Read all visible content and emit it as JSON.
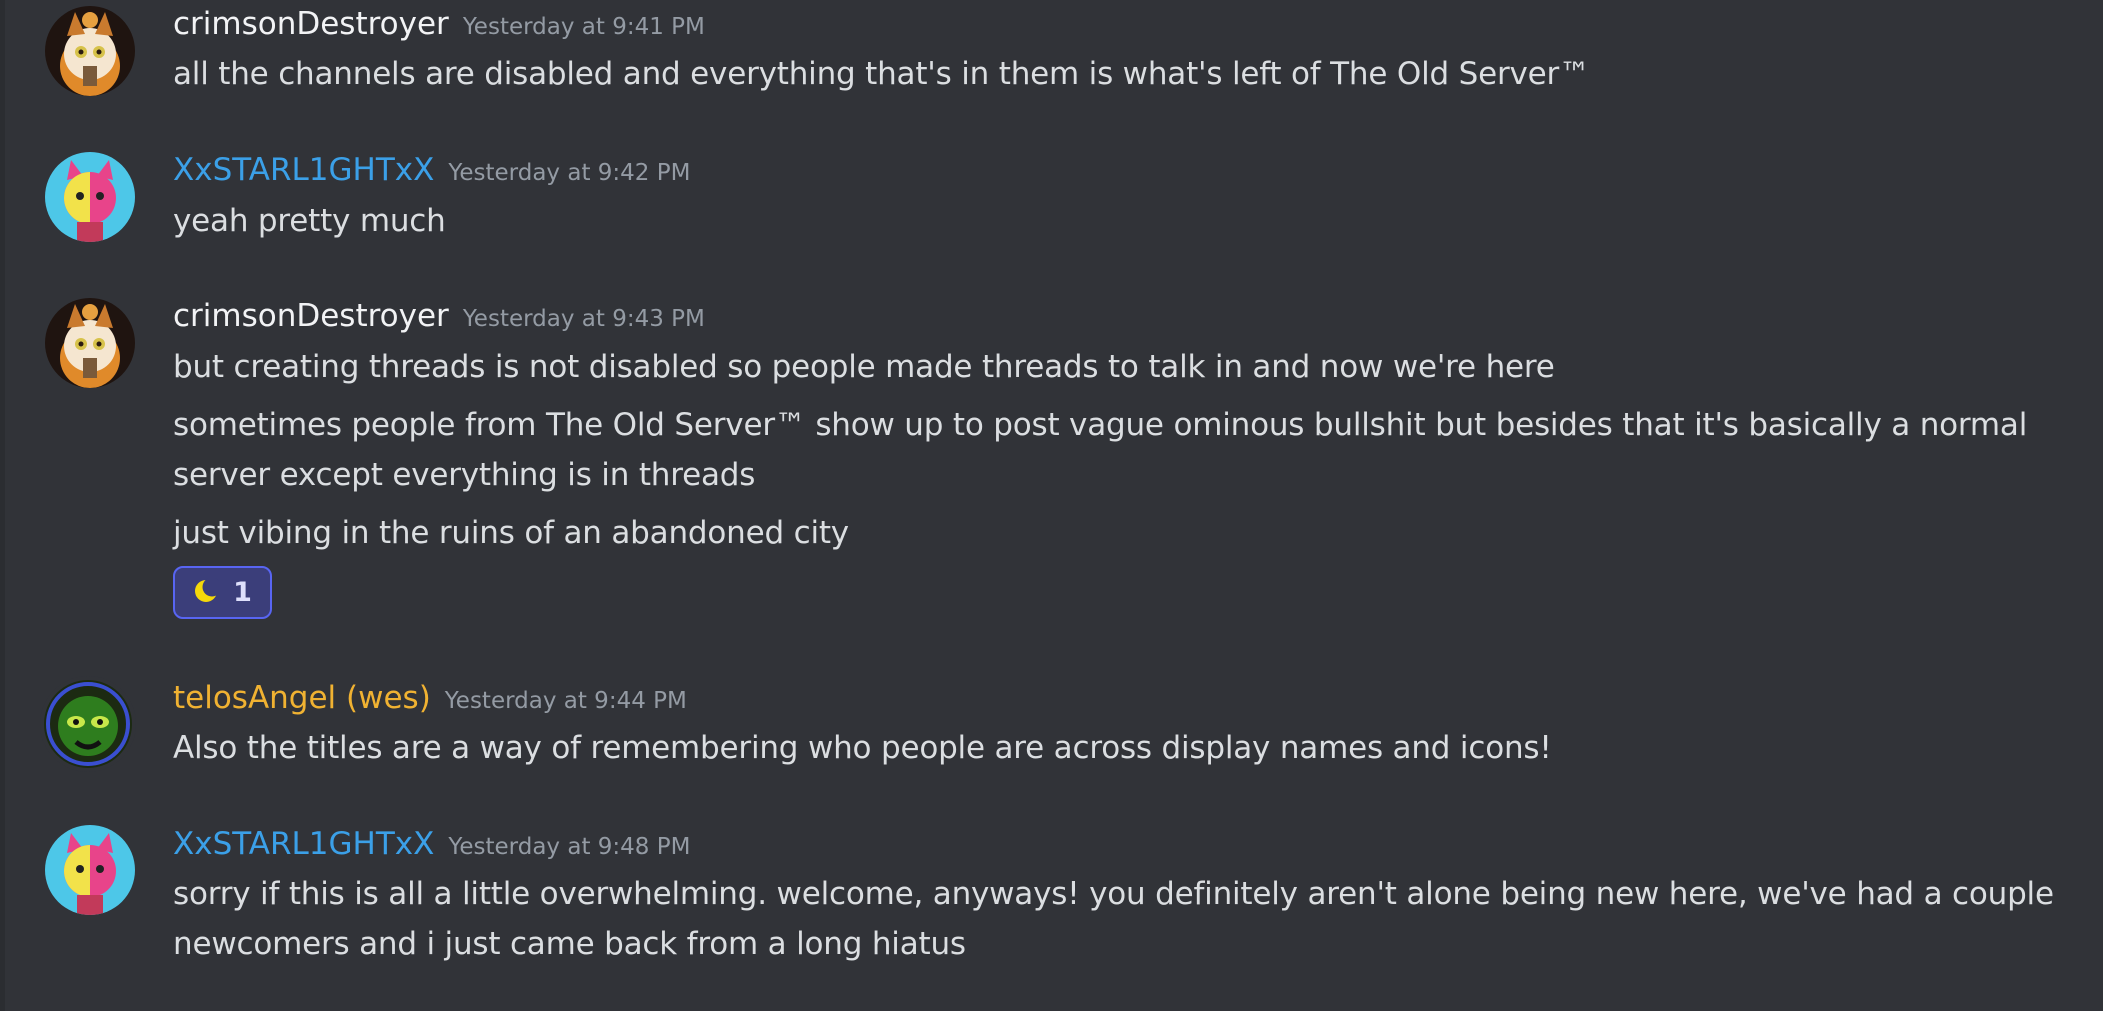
{
  "messages": [
    {
      "author": "crimsonDestroyer",
      "timestamp": "Yesterday at 9:41 PM",
      "avatar": "fox-avatar",
      "lines": [
        "all the channels are disabled and everything that's in them is what's left of The Old Server™"
      ]
    },
    {
      "author": "XxSTARL1GHTxX",
      "timestamp": "Yesterday at 9:42 PM",
      "avatar": "pink-cat-avatar",
      "lines": [
        "yeah pretty much"
      ]
    },
    {
      "author": "crimsonDestroyer",
      "timestamp": "Yesterday at 9:43 PM",
      "avatar": "fox-avatar",
      "lines": [
        "but creating threads is not disabled so people made threads to talk in and now we're here",
        "sometimes people from The Old Server™ show up to post vague ominous bullshit but besides that it's basically a normal",
        "server except everything is in threads",
        "just vibing in the ruins of an abandoned city"
      ],
      "reaction": {
        "emoji": "crescent-moon-icon",
        "count": "1"
      }
    },
    {
      "author": "telosAngel (wes)",
      "timestamp": "Yesterday at 9:44 PM",
      "avatar": "green-mask-avatar",
      "lines": [
        "Also the titles are a way of remembering who people are across display names and icons!"
      ]
    },
    {
      "author": "XxSTARL1GHTxX",
      "timestamp": "Yesterday at 9:48 PM",
      "avatar": "pink-cat-avatar",
      "lines": [
        "sorry if this is all a little overwhelming. welcome, anyways! you definitely aren't alone being new here, we've had a couple",
        "newcomers and i just came back from a long hiatus"
      ]
    }
  ],
  "colors": {
    "background": "#313338",
    "username_default": "#f2f3f5",
    "username_blue": "#3ba0e8",
    "username_gold": "#f0b232",
    "message_text": "#dbdee1",
    "timestamp": "#949ba4",
    "reaction_border": "#5865f2"
  }
}
